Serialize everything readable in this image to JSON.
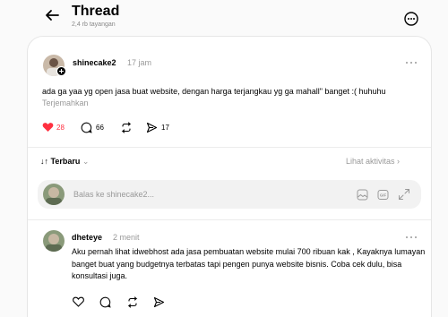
{
  "header": {
    "title": "Thread",
    "views": "2,4 rb tayangan"
  },
  "post": {
    "username": "shinecake2",
    "time": "17 jam",
    "text": "ada ga yaa yg open jasa buat website, dengan harga terjangkau yg ga mahall\" banget :( huhuhu",
    "translate_label": "Terjemahkan",
    "likes": "28",
    "comments": "66",
    "shares": "17",
    "liked": true
  },
  "sort": {
    "label": "Terbaru",
    "chevron": "⌄",
    "activity_label": "Lihat aktivitas ›"
  },
  "reply_box": {
    "placeholder": "Balas ke shinecake2..."
  },
  "reply": {
    "username": "dheteye",
    "time": "2 menit",
    "text": "Aku pernah lihat idwebhost ada jasa pembuatan website mulai 700 ribuan kak , Kayaknya lumayan banget buat yang budgetnya terbatas tapi pengen punya website bisnis. Coba cek dulu, bisa konsultasi juga."
  },
  "colors": {
    "like": "#ff3040",
    "muted": "#999999"
  }
}
